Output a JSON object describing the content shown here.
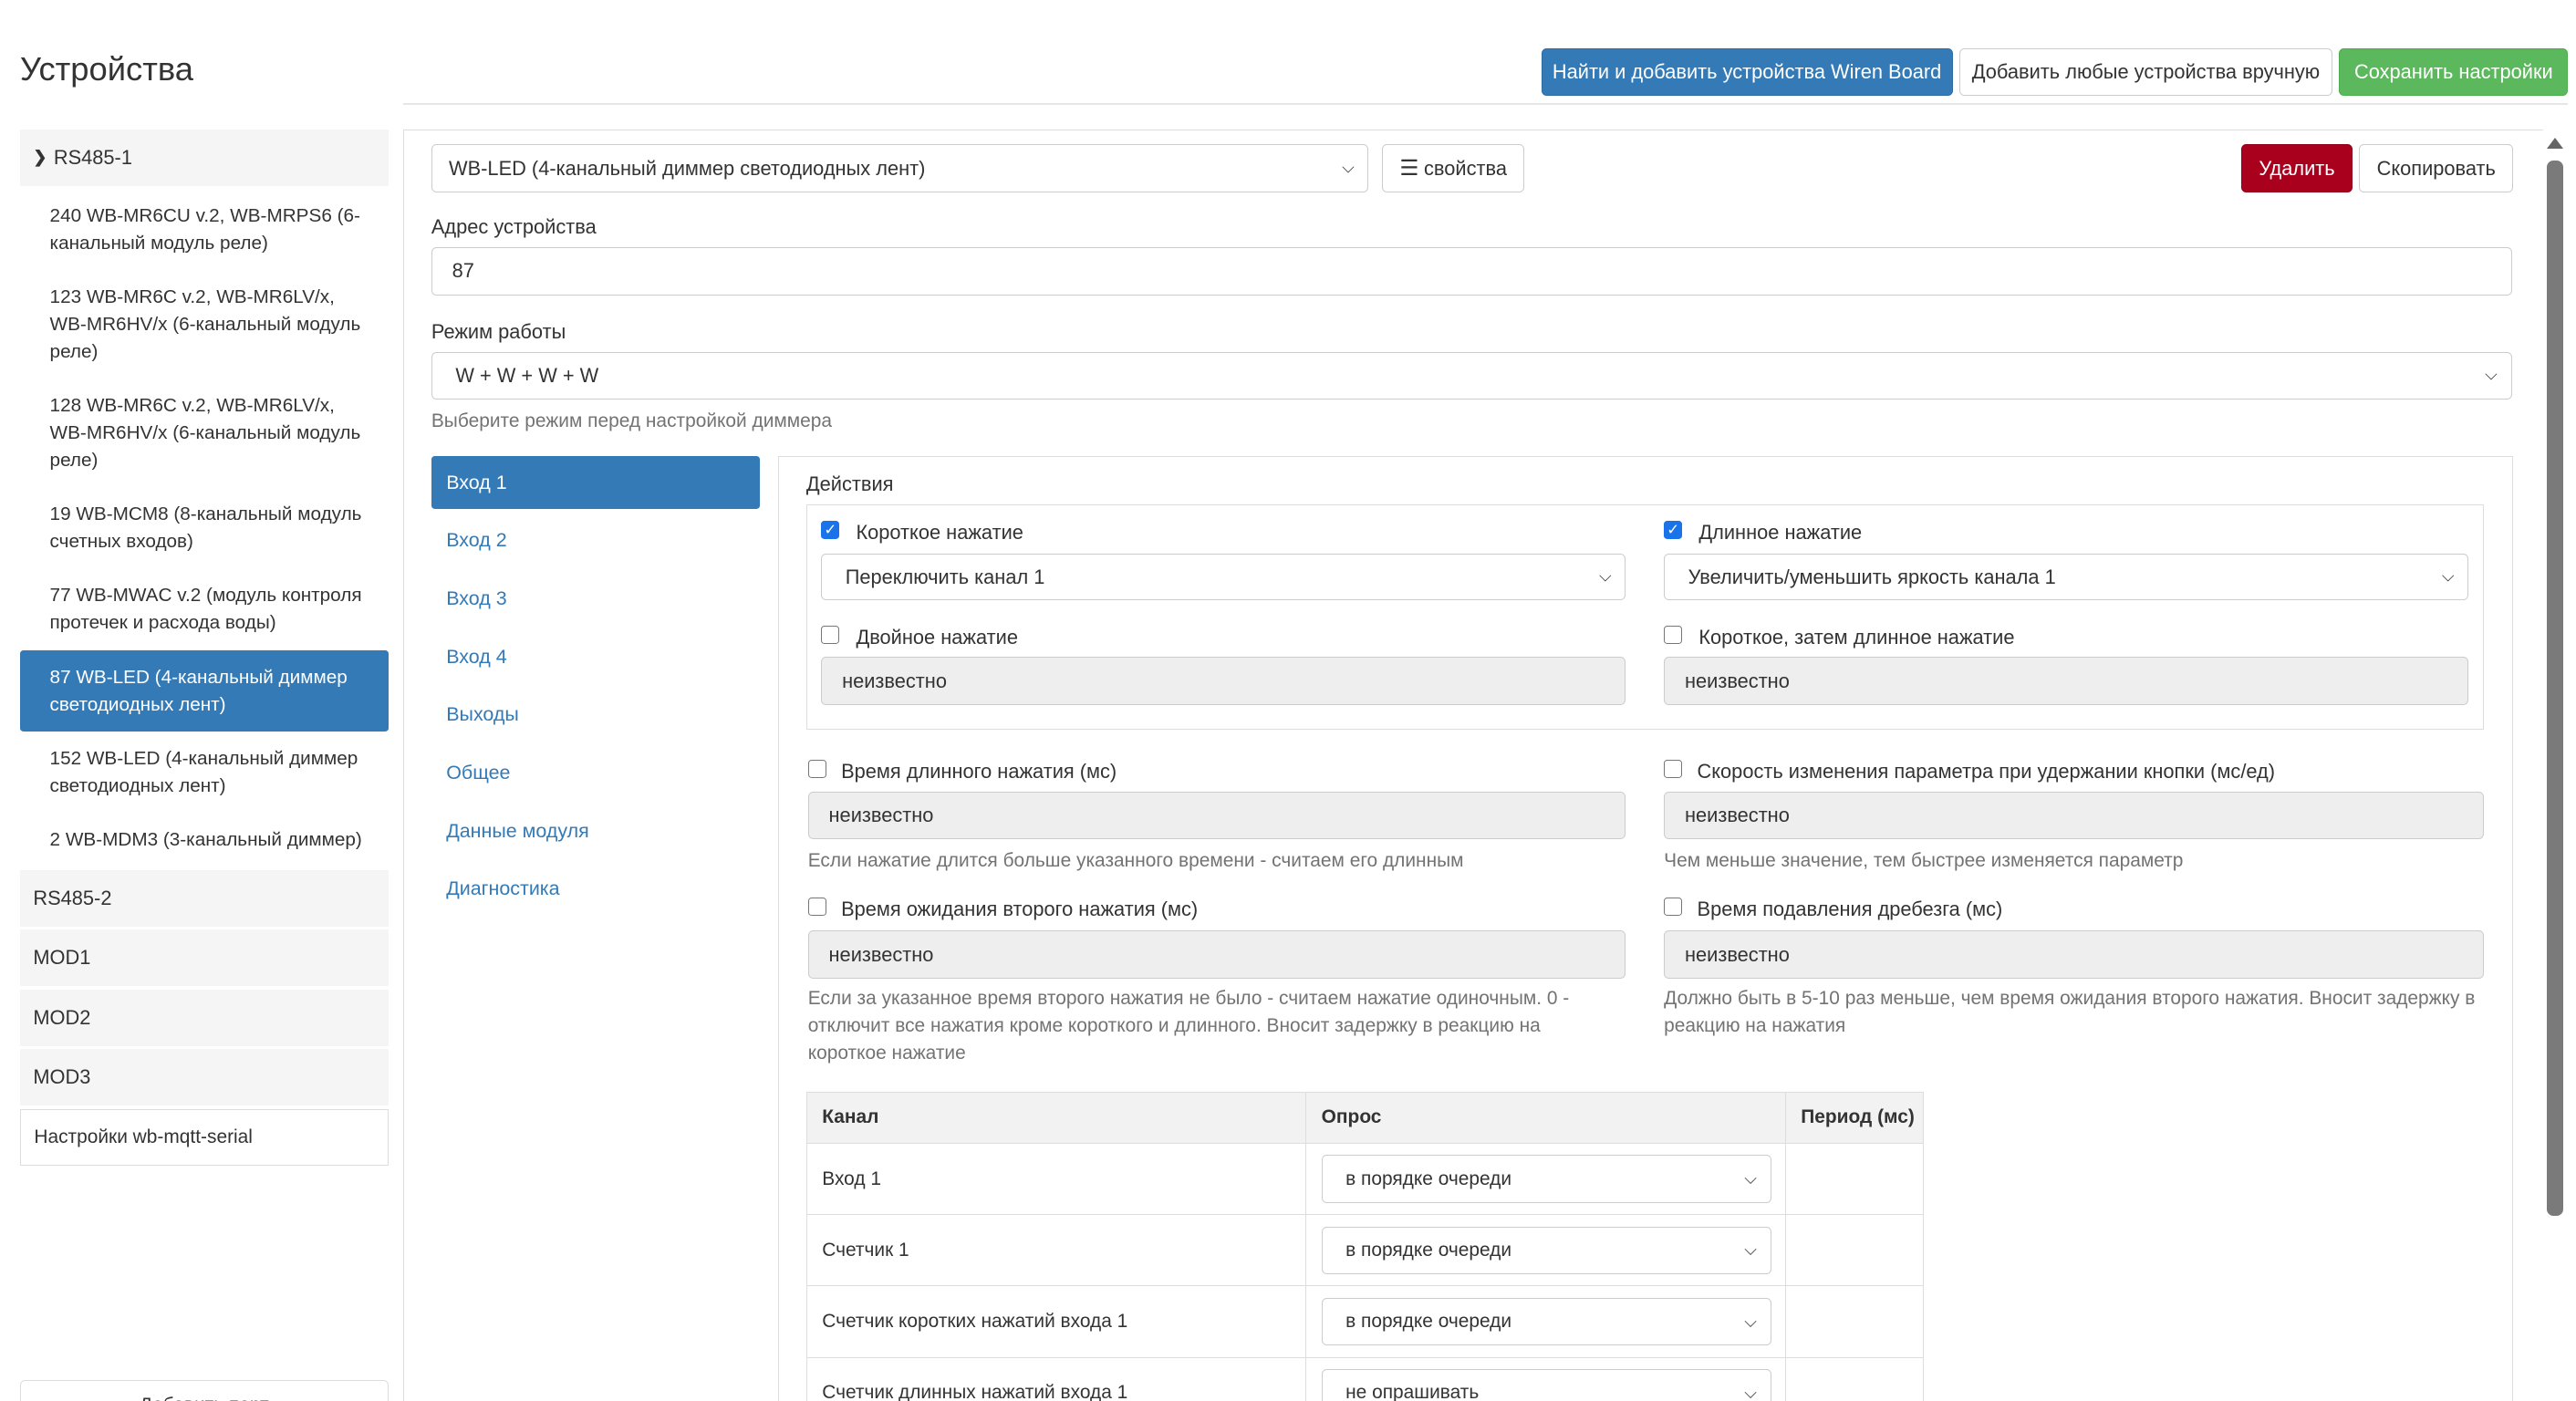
{
  "header": {
    "title": "Устройства",
    "find_button": "Найти и добавить устройства Wiren Board",
    "add_manual_button": "Добавить любые устройства вручную",
    "save_button": "Сохранить настройки"
  },
  "sidebar": {
    "port1": "RS485-1",
    "devices": [
      "240 WB-MR6CU v.2, WB-MRPS6 (6-канальный модуль реле)",
      "123 WB-MR6C v.2, WB-MR6LV/x, WB-MR6HV/x (6-канальный модуль реле)",
      "128 WB-MR6C v.2, WB-MR6LV/x, WB-MR6HV/x (6-канальный модуль реле)",
      "19 WB-MCM8 (8-канальный модуль счетных входов)",
      "77 WB-MWAC v.2 (модуль контроля протечек и расхода воды)",
      "87 WB-LED (4-канальный диммер светодиодных лент)",
      "152 WB-LED (4-канальный диммер светодиодных лент)",
      "2 WB-MDM3 (3-канальный диммер)"
    ],
    "ports": [
      "RS485-2",
      "MOD1",
      "MOD2",
      "MOD3"
    ],
    "settings": "Настройки wb-mqtt-serial",
    "add_port": "Добавить порт"
  },
  "device": {
    "type_select": "WB-LED (4-канальный диммер светодиодных лент)",
    "properties_button": "свойства",
    "delete_button": "Удалить",
    "copy_button": "Скопировать",
    "address_label": "Адрес устройства",
    "address_value": "87",
    "mode_label": "Режим работы",
    "mode_value": "W + W + W + W",
    "mode_help": "Выберите режим перед настройкой диммера"
  },
  "tabs": [
    "Вход 1",
    "Вход 2",
    "Вход 3",
    "Вход 4",
    "Выходы",
    "Общее",
    "Данные модуля",
    "Диагностика"
  ],
  "actions": {
    "title": "Действия",
    "short_press": "Короткое нажатие",
    "short_value": "Переключить канал 1",
    "long_press": "Длинное нажатие",
    "long_value": "Увеличить/уменьшить яркость канала 1",
    "double_press": "Двойное нажатие",
    "double_value": "неизвестно",
    "short_long_press": "Короткое, затем длинное нажатие",
    "short_long_value": "неизвестно"
  },
  "params": {
    "long_time_label": "Время длинного нажатия (мс)",
    "long_time_value": "неизвестно",
    "long_time_help": "Если нажатие длится больше указанного времени - считаем его длинным",
    "speed_label": "Скорость изменения параметра при удержании кнопки (мс/ед)",
    "speed_value": "неизвестно",
    "speed_help": "Чем меньше значение, тем быстрее изменяется параметр",
    "second_label": "Время ожидания второго нажатия (мс)",
    "second_value": "неизвестно",
    "second_help": "Если за указанное время второго нажатия не было - считаем нажатие одиночным. 0 - отключит все нажатия кроме короткого и длинного. Вносит задержку в реакцию на короткое нажатие",
    "debounce_label": "Время подавления дребезга (мс)",
    "debounce_value": "неизвестно",
    "debounce_help": "Должно быть в 5-10 раз меньше, чем время ожидания второго нажатия. Вносит задержку в реакцию на нажатия"
  },
  "table": {
    "headers": [
      "Канал",
      "Опрос",
      "Период (мс)"
    ],
    "rows": [
      {
        "channel": "Вход 1",
        "poll": "в порядке очереди"
      },
      {
        "channel": "Счетчик 1",
        "poll": "в порядке очереди"
      },
      {
        "channel": "Счетчик коротких нажатий входа 1",
        "poll": "в порядке очереди"
      },
      {
        "channel": "Счетчик длинных нажатий входа 1",
        "poll": "не опрашивать"
      }
    ]
  }
}
